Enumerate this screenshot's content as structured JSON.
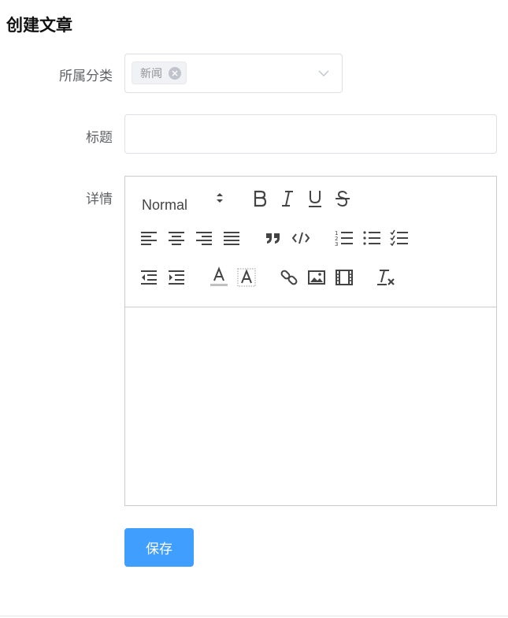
{
  "page": {
    "title": "创建文章"
  },
  "form": {
    "category": {
      "label": "所属分类",
      "selected_tags": [
        "新闻"
      ]
    },
    "title": {
      "label": "标题",
      "value": "",
      "placeholder": ""
    },
    "detail": {
      "label": "详情"
    }
  },
  "editor": {
    "header_picker": "Normal",
    "toolbar_icons": [
      "bold-icon",
      "italic-icon",
      "underline-icon",
      "strikethrough-icon",
      "align-left-icon",
      "align-center-icon",
      "align-right-icon",
      "align-justify-icon",
      "blockquote-icon",
      "code-block-icon",
      "ordered-list-icon",
      "bullet-list-icon",
      "check-list-icon",
      "outdent-icon",
      "indent-icon",
      "font-color-icon",
      "background-color-icon",
      "link-icon",
      "image-icon",
      "video-icon",
      "clean-format-icon"
    ],
    "content": ""
  },
  "actions": {
    "save_label": "保存"
  },
  "colors": {
    "primary": "#409eff",
    "border": "#dcdfe6",
    "text": "#606266"
  }
}
